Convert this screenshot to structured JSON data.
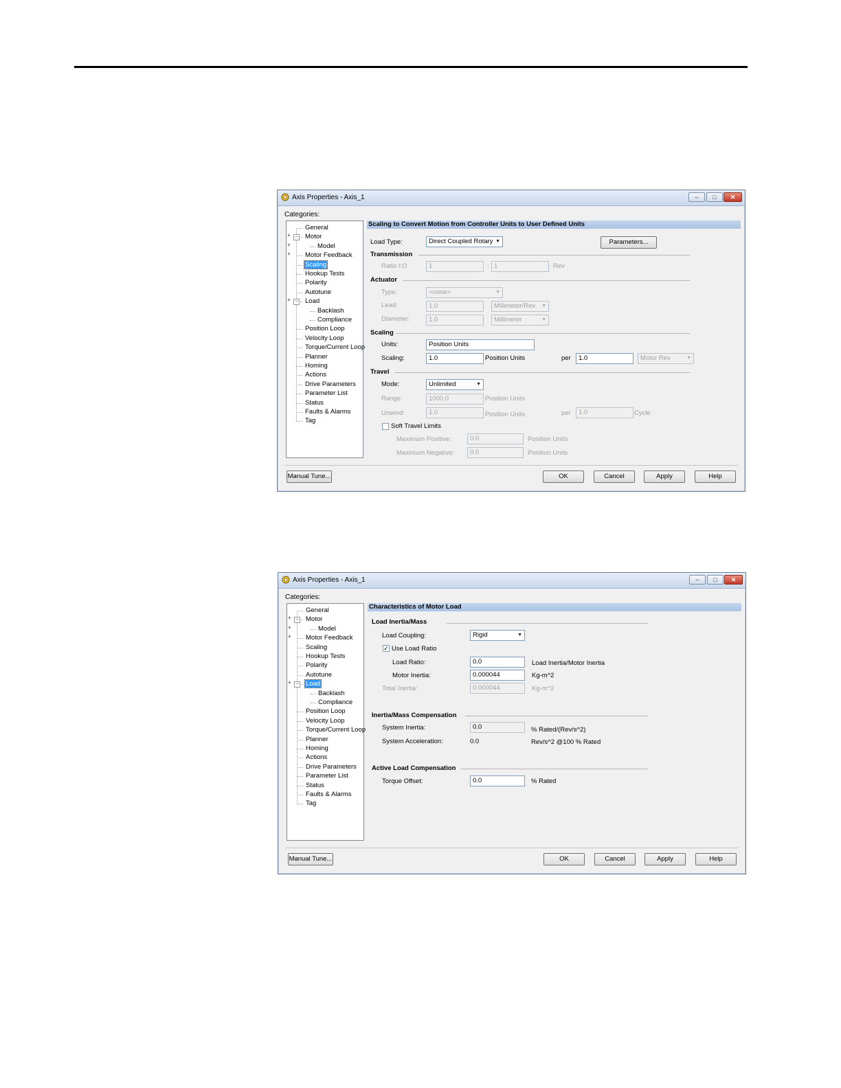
{
  "dialog1": {
    "title": "Axis Properties - Axis_1",
    "categories_label": "Categories:",
    "tree": [
      {
        "label": "General",
        "level": 0,
        "selected": false
      },
      {
        "label": "Motor",
        "level": 0,
        "selected": false
      },
      {
        "label": "Model",
        "level": 1,
        "selected": false
      },
      {
        "label": "Motor Feedback",
        "level": 0,
        "selected": false
      },
      {
        "label": "Scaling",
        "level": 0,
        "selected": true
      },
      {
        "label": "Hookup Tests",
        "level": 0,
        "selected": false
      },
      {
        "label": "Polarity",
        "level": 0,
        "selected": false
      },
      {
        "label": "Autotune",
        "level": 0,
        "selected": false
      },
      {
        "label": "Load",
        "level": 0,
        "selected": false
      },
      {
        "label": "Backlash",
        "level": 1,
        "selected": false
      },
      {
        "label": "Compliance",
        "level": 1,
        "selected": false
      },
      {
        "label": "Position Loop",
        "level": 0,
        "selected": false
      },
      {
        "label": "Velocity Loop",
        "level": 0,
        "selected": false
      },
      {
        "label": "Torque/Current Loop",
        "level": 0,
        "selected": false
      },
      {
        "label": "Planner",
        "level": 0,
        "selected": false
      },
      {
        "label": "Homing",
        "level": 0,
        "selected": false
      },
      {
        "label": "Actions",
        "level": 0,
        "selected": false
      },
      {
        "label": "Drive Parameters",
        "level": 0,
        "selected": false
      },
      {
        "label": "Parameter List",
        "level": 0,
        "selected": false
      },
      {
        "label": "Status",
        "level": 0,
        "selected": false
      },
      {
        "label": "Faults & Alarms",
        "level": 0,
        "selected": false
      },
      {
        "label": "Tag",
        "level": 0,
        "selected": false
      }
    ],
    "panel_title": "Scaling to Convert Motion from Controller Units to User Defined Units",
    "load_type_label": "Load Type:",
    "load_type_value": "Direct Coupled Rotary",
    "parameters_button": "Parameters...",
    "transmission": {
      "heading": "Transmission",
      "ratio_label": "Ratio I:O",
      "ratio_in": "1",
      "colon": ":",
      "ratio_out": "1",
      "rev_label": "Rev"
    },
    "actuator": {
      "heading": "Actuator",
      "type_label": "Type:",
      "type_value": "<none>",
      "lead_label": "Lead:",
      "lead_value": "1.0",
      "lead_unit": "Millimeter/Rev",
      "diameter_label": "Diameter:",
      "diameter_value": "1.0",
      "diameter_unit": "Millimeter"
    },
    "scaling": {
      "heading": "Scaling",
      "units_label": "Units:",
      "units_value": "Position Units",
      "scaling_label": "Scaling:",
      "scaling_value": "1.0",
      "position_units": "Position Units",
      "per_label": "per",
      "per_value": "1.0",
      "per_unit": "Motor Rev"
    },
    "travel": {
      "heading": "Travel",
      "mode_label": "Mode:",
      "mode_value": "Unlimited",
      "range_label": "Range:",
      "range_value": "1000.0",
      "range_unit": "Position Units",
      "unwind_label": "Unwind:",
      "unwind_value": "1.0",
      "unwind_unit": "Position Units",
      "per_label": "per",
      "per_value": "1.0",
      "cycle_label": "Cycle",
      "soft_limits_label": "Soft Travel Limits",
      "soft_limits_checked": false,
      "max_pos_label": "Maximum Positive:",
      "max_pos_value": "0.0",
      "max_pos_unit": "Position Units",
      "max_neg_label": "Maximum Negative:",
      "max_neg_value": "0.0",
      "max_neg_unit": "Position Units"
    },
    "buttons": {
      "manual_tune": "Manual Tune...",
      "ok": "OK",
      "cancel": "Cancel",
      "apply": "Apply",
      "help": "Help"
    }
  },
  "dialog2": {
    "title": "Axis Properties - Axis_1",
    "categories_label": "Categories:",
    "tree": [
      {
        "label": "General",
        "level": 0,
        "selected": false
      },
      {
        "label": "Motor",
        "level": 0,
        "selected": false
      },
      {
        "label": "Model",
        "level": 1,
        "selected": false
      },
      {
        "label": "Motor Feedback",
        "level": 0,
        "selected": false
      },
      {
        "label": "Scaling",
        "level": 0,
        "selected": false
      },
      {
        "label": "Hookup Tests",
        "level": 0,
        "selected": false
      },
      {
        "label": "Polarity",
        "level": 0,
        "selected": false
      },
      {
        "label": "Autotune",
        "level": 0,
        "selected": false
      },
      {
        "label": "Load",
        "level": 0,
        "selected": true
      },
      {
        "label": "Backlash",
        "level": 1,
        "selected": false
      },
      {
        "label": "Compliance",
        "level": 1,
        "selected": false
      },
      {
        "label": "Position Loop",
        "level": 0,
        "selected": false
      },
      {
        "label": "Velocity Loop",
        "level": 0,
        "selected": false
      },
      {
        "label": "Torque/Current Loop",
        "level": 0,
        "selected": false
      },
      {
        "label": "Planner",
        "level": 0,
        "selected": false
      },
      {
        "label": "Homing",
        "level": 0,
        "selected": false
      },
      {
        "label": "Actions",
        "level": 0,
        "selected": false
      },
      {
        "label": "Drive Parameters",
        "level": 0,
        "selected": false
      },
      {
        "label": "Parameter List",
        "level": 0,
        "selected": false
      },
      {
        "label": "Status",
        "level": 0,
        "selected": false
      },
      {
        "label": "Faults & Alarms",
        "level": 0,
        "selected": false
      },
      {
        "label": "Tag",
        "level": 0,
        "selected": false
      }
    ],
    "panel_title": "Characteristics of Motor Load",
    "inertia": {
      "heading": "Load Inertia/Mass",
      "coupling_label": "Load Coupling:",
      "coupling_value": "Rigid",
      "use_ratio_label": "Use Load Ratio",
      "use_ratio_checked": true,
      "ratio_label": "Load Ratio:",
      "ratio_value": "0.0",
      "ratio_unit": "Load Inertia/Motor Inertia",
      "motor_inertia_label": "Motor Inertia:",
      "motor_inertia_value": "0.000044",
      "motor_inertia_unit": "Kg-m^2",
      "total_inertia_label": "Total Inertia:",
      "total_inertia_value": "0.000044",
      "total_inertia_unit": "Kg-m^2"
    },
    "compensation": {
      "heading": "Inertia/Mass Compensation",
      "system_inertia_label": "System Inertia:",
      "system_inertia_value": "0.0",
      "system_inertia_unit": "% Rated/(Rev/s^2)",
      "system_accel_label": "System Acceleration:",
      "system_accel_value": "0.0",
      "system_accel_unit": "Rev/s^2 @100 % Rated"
    },
    "active": {
      "heading": "Active Load Compensation",
      "torque_offset_label": "Torque Offset:",
      "torque_offset_value": "0.0",
      "torque_offset_unit": "% Rated"
    },
    "buttons": {
      "manual_tune": "Manual Tune...",
      "ok": "OK",
      "cancel": "Cancel",
      "apply": "Apply",
      "help": "Help"
    }
  }
}
